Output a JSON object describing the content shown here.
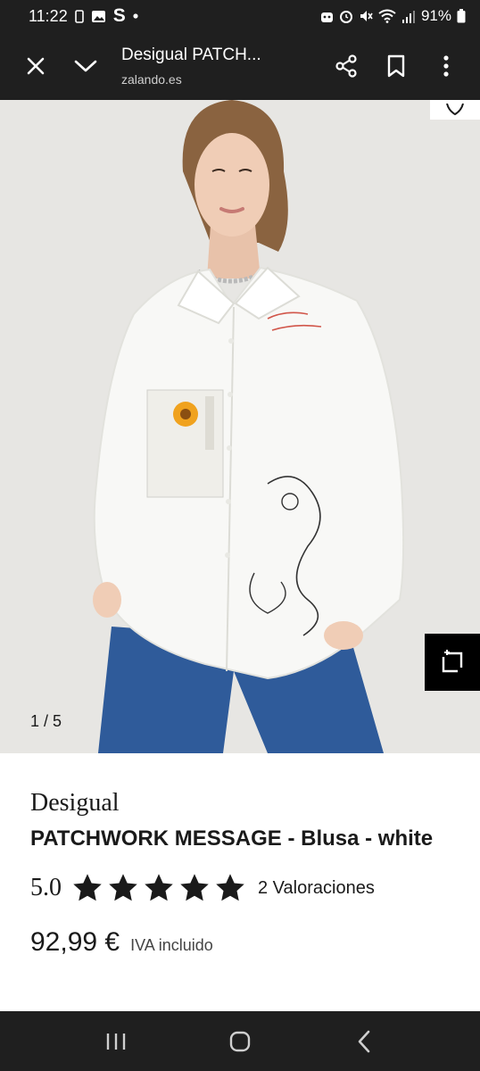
{
  "status_bar": {
    "time": "11:22",
    "battery": "91%",
    "left_icons": [
      "phone-icon",
      "gallery-icon",
      "s-app-icon",
      "notification-dot-icon"
    ],
    "right_icons": [
      "robot-icon",
      "alarm-icon",
      "mute-icon",
      "wifi-icon",
      "signal-icon",
      "battery-icon"
    ]
  },
  "toolbar": {
    "title": "Desigual PATCH...",
    "domain": "zalando.es",
    "icons": [
      "close-icon",
      "chevron-down-icon",
      "share-icon",
      "bookmark-icon",
      "more-vert-icon"
    ]
  },
  "gallery": {
    "counter": "1 / 5",
    "background": "#e7e6e3"
  },
  "product": {
    "brand": "Desigual",
    "name": "PATCHWORK MESSAGE - Blusa - white",
    "rating": "5.0",
    "rating_stars": 5,
    "reviews": "2 Valoraciones",
    "price": "92,99 €",
    "tax_note": "IVA incluido"
  },
  "colors": {
    "chrome": "#1f1f1f",
    "text": "#1a1a1a"
  }
}
